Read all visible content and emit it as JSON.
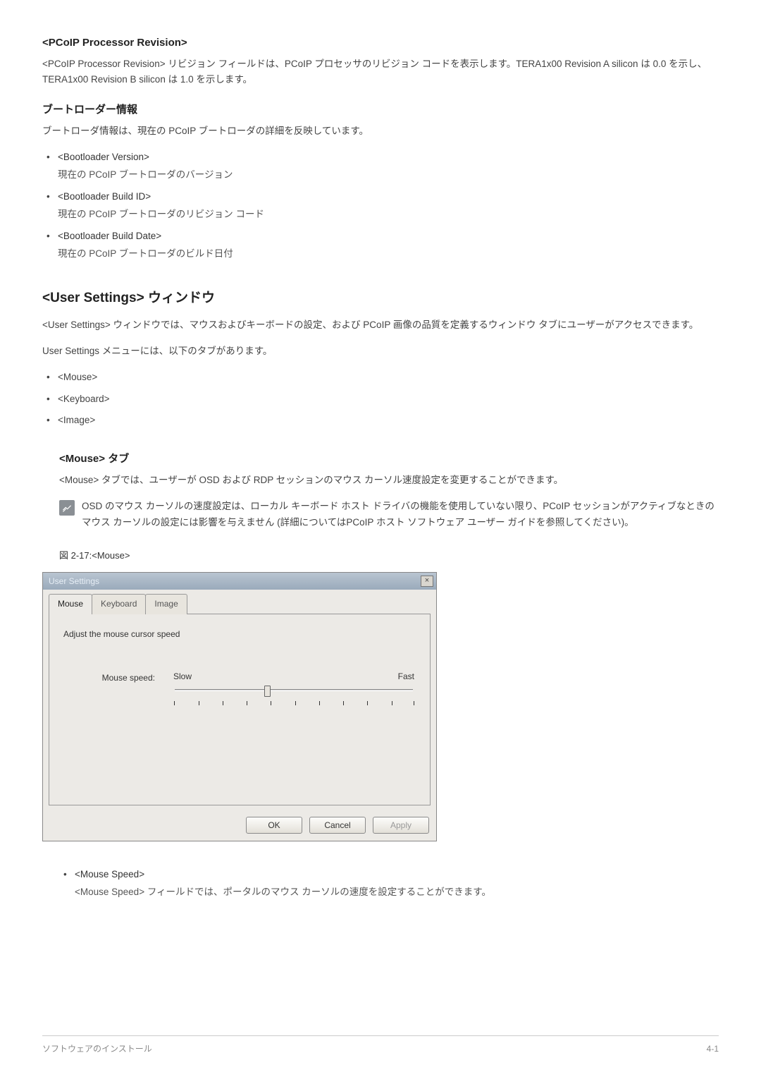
{
  "sec_processor": {
    "title": "<PCoIP Processor Revision>",
    "body": "<PCoIP Processor Revision> リビジョン フィールドは、PCoIP プロセッサのリビジョン コードを表示します。TERA1x00 Revision A silicon は 0.0 を示し、TERA1x00 Revision B silicon は 1.0 を示します。"
  },
  "sec_bootloader": {
    "title": "ブートローダー情報",
    "lead": "ブートローダ情報は、現在の PCoIP ブートローダの詳細を反映しています。",
    "items": [
      {
        "label": "<Bootloader Version>",
        "desc": "現在の PCoIP ブートローダのバージョン"
      },
      {
        "label": "<Bootloader Build ID>",
        "desc": "現在の PCoIP ブートローダのリビジョン コード"
      },
      {
        "label": "<Bootloader Build Date>",
        "desc": "現在の PCoIP ブートローダのビルド日付"
      }
    ]
  },
  "sec_user_settings": {
    "title": "<User Settings> ウィンドウ",
    "p1": "<User Settings> ウィンドウでは、マウスおよびキーボードの設定、および PCoIP 画像の品質を定義するウィンドウ タブにユーザーがアクセスできます。",
    "p2": "User Settings メニューには、以下のタブがあります。",
    "tabs_list": [
      "<Mouse>",
      "<Keyboard>",
      "<Image>"
    ]
  },
  "sec_mouse_tab": {
    "title": "<Mouse> タブ",
    "lead": "<Mouse> タブでは、ユーザーが OSD および RDP セッションのマウス カーソル速度設定を変更することができます。",
    "note": "OSD のマウス カーソルの速度設定は、ローカル キーボード ホスト ドライバの機能を使用していない限り、PCoIP セッションがアクティブなときのマウス カーソルの設定には影響を与えません (詳細についてはPCoIP ホスト ソフトウェア ユーザー ガイドを参照してください)。",
    "figure_caption": "図 2-17:<Mouse>",
    "mouse_speed_item": {
      "label": "<Mouse Speed>",
      "desc": "<Mouse Speed> フィールドでは、ポータルのマウス カーソルの速度を設定することができます。"
    }
  },
  "ui_window": {
    "title": "User Settings",
    "close": "×",
    "tabs": {
      "mouse": "Mouse",
      "keyboard": "Keyboard",
      "image": "Image"
    },
    "panel_heading": "Adjust the mouse cursor speed",
    "slider_label": "Mouse speed:",
    "slow": "Slow",
    "fast": "Fast",
    "buttons": {
      "ok": "OK",
      "cancel": "Cancel",
      "apply": "Apply"
    }
  },
  "footer": {
    "left": "ソフトウェアのインストール",
    "right": "4-1"
  }
}
